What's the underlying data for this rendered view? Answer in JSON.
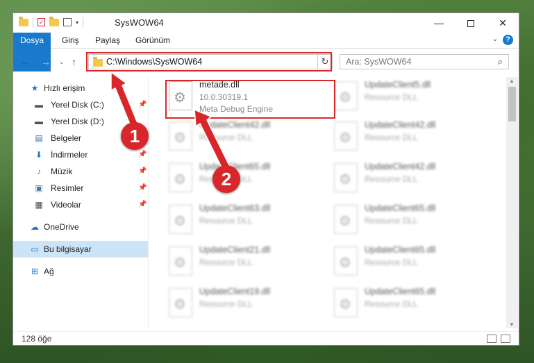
{
  "window": {
    "title": "SysWOW64"
  },
  "ribbon": {
    "tabs": [
      "Dosya",
      "Giriş",
      "Paylaş",
      "Görünüm"
    ]
  },
  "address": {
    "path": "C:\\Windows\\SysWOW64"
  },
  "search": {
    "placeholder": "Ara: SysWOW64"
  },
  "sidebar": {
    "items": [
      {
        "label": "Hızlı erişim",
        "icon": "star-icon"
      },
      {
        "label": "Yerel Disk (C:)",
        "icon": "drive-icon"
      },
      {
        "label": "Yerel Disk (D:)",
        "icon": "drive-icon"
      },
      {
        "label": "Belgeler",
        "icon": "documents-icon"
      },
      {
        "label": "İndirmeler",
        "icon": "download-icon"
      },
      {
        "label": "Müzik",
        "icon": "music-icon"
      },
      {
        "label": "Resimler",
        "icon": "pictures-icon"
      },
      {
        "label": "Videolar",
        "icon": "videos-icon"
      },
      {
        "label": "OneDrive",
        "icon": "cloud-icon"
      },
      {
        "label": "Bu bilgisayar",
        "icon": "computer-icon"
      },
      {
        "label": "Ağ",
        "icon": "network-icon"
      }
    ]
  },
  "files": {
    "selected": {
      "name": "metade.dll",
      "version": "10.0.30319.1",
      "description": "Meta Debug Engine"
    },
    "left": [
      {
        "name": "UpdateClient42.dll",
        "type": "Resource DLL"
      },
      {
        "name": "UpdateClient65.dll",
        "type": "Resource DLL"
      },
      {
        "name": "UpdateClient63.dll",
        "type": "Resource DLL"
      },
      {
        "name": "UpdateClient21.dll",
        "type": "Resource DLL"
      },
      {
        "name": "UpdateClient19.dll",
        "type": "Resource DLL"
      }
    ],
    "right": [
      {
        "name": "UpdateClient5.dll",
        "type": "Resource DLL"
      },
      {
        "name": "UpdateClient42.dll",
        "type": "Resource DLL"
      },
      {
        "name": "UpdateClient42.dll",
        "type": "Resource DLL"
      },
      {
        "name": "UpdateClient65.dll",
        "type": "Resource DLL"
      },
      {
        "name": "UpdateClient65.dll",
        "type": "Resource DLL"
      },
      {
        "name": "UpdateClient65.dll",
        "type": "Resource DLL"
      }
    ]
  },
  "status": {
    "count": "128 öğe"
  },
  "callouts": {
    "one": "1",
    "two": "2"
  },
  "colors": {
    "accent": "#1979ca",
    "highlight": "#d9262a",
    "selected": "#cce4f7"
  }
}
